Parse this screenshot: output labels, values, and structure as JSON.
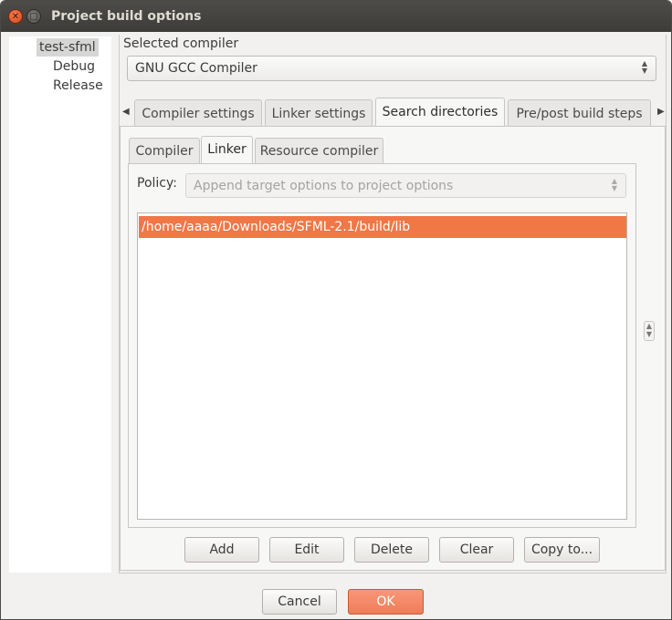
{
  "window": {
    "title": "Project build options",
    "accent": "#f07746"
  },
  "tree": {
    "root": "test-sfml",
    "children": [
      "Debug",
      "Release"
    ]
  },
  "selected_compiler": {
    "label": "Selected compiler",
    "value": "GNU GCC Compiler"
  },
  "tabs": [
    {
      "label": "Compiler settings",
      "active": false
    },
    {
      "label": "Linker settings",
      "active": false
    },
    {
      "label": "Search directories",
      "active": true
    },
    {
      "label": "Pre/post build steps",
      "active": false
    }
  ],
  "inner_tabs": [
    {
      "label": "Compiler",
      "active": false
    },
    {
      "label": "Linker",
      "active": true
    },
    {
      "label": "Resource compiler",
      "active": false
    }
  ],
  "policy": {
    "label": "Policy:",
    "value": "Append target options to project options"
  },
  "directories": [
    "/home/aaaa/Downloads/SFML-2.1/build/lib"
  ],
  "actions": {
    "add": "Add",
    "edit": "Edit",
    "delete": "Delete",
    "clear": "Clear",
    "copy_to": "Copy to..."
  },
  "footer": {
    "cancel": "Cancel",
    "ok": "OK"
  }
}
